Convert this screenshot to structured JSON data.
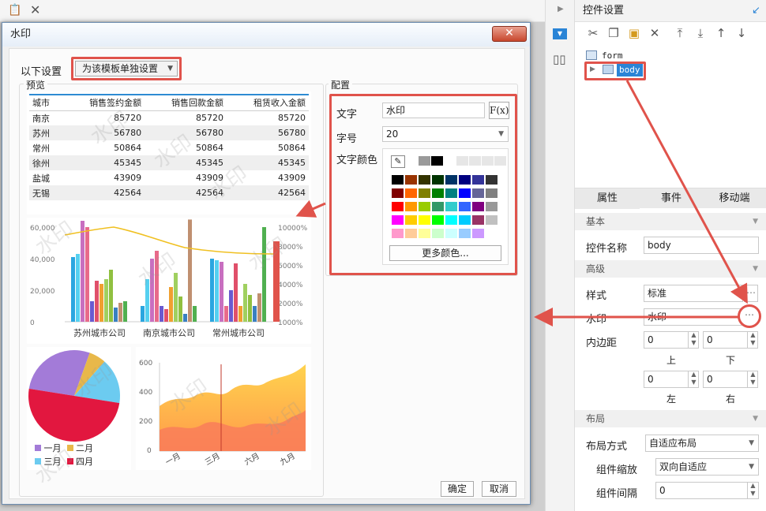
{
  "right_panel": {
    "title": "控件设置",
    "tree": {
      "form": "form",
      "body": "body"
    },
    "tabs": [
      "属性",
      "事件",
      "移动端"
    ],
    "basic": {
      "section": "基本",
      "name_label": "控件名称",
      "name_value": "body"
    },
    "advanced": {
      "section": "高级",
      "style_label": "样式",
      "style_value": "标准",
      "watermark_label": "水印",
      "watermark_value": "水印",
      "padding_label": "内边距",
      "pad_top": "0",
      "pad_bottom": "0",
      "pad_left": "0",
      "pad_right": "0",
      "top": "上",
      "bottom": "下",
      "left": "左",
      "right": "右"
    },
    "layout": {
      "section": "布局",
      "mode_label": "布局方式",
      "mode_value": "自适应布局",
      "scale_label": "组件缩放",
      "scale_value": "双向自适应",
      "gap_label": "组件间隔",
      "gap_value": "0"
    }
  },
  "dialog": {
    "title": "水印",
    "scope_label": "以下设置",
    "scope_value": "为该模板单独设置",
    "preview_label": "预览",
    "config_label": "配置",
    "text_label": "文字",
    "text_value": "水印",
    "fx": "F(x)",
    "size_label": "字号",
    "size_value": "20",
    "color_label": "文字颜色",
    "more_colors": "更多颜色...",
    "ok": "确定",
    "cancel": "取消",
    "watermark_text": "水印"
  },
  "preview_table": {
    "headers": [
      "城市",
      "销售签约金额",
      "销售回款金额",
      "租赁收入金额"
    ],
    "rows": [
      [
        "南京",
        "85720",
        "85720",
        "85720"
      ],
      [
        "苏州",
        "56780",
        "56780",
        "56780"
      ],
      [
        "常州",
        "50864",
        "50864",
        "50864"
      ],
      [
        "徐州",
        "45345",
        "45345",
        "45345"
      ],
      [
        "盐城",
        "43909",
        "43909",
        "43909"
      ],
      [
        "无锡",
        "42564",
        "42564",
        "42564"
      ]
    ]
  },
  "chart_data": [
    {
      "type": "bar",
      "categories": [
        "苏州城市公司",
        "南京城市公司",
        "常州城市公司"
      ],
      "yticks": [
        "60,000",
        "40,000",
        "20,000",
        "0"
      ],
      "y2ticks": [
        "10000%",
        "8000%",
        "6000%",
        "4000%",
        "2000%",
        "1000%"
      ],
      "ylim": [
        0,
        60000
      ],
      "series": [
        {
          "values": [
            41000,
            10000,
            40000
          ],
          "color": "#2aa6e0"
        },
        {
          "values": [
            43000,
            27000,
            39000
          ],
          "color": "#55d0f0"
        },
        {
          "values": [
            64000,
            40000,
            38000
          ],
          "color": "#c86fc0"
        },
        {
          "values": [
            60000,
            45000,
            10000
          ],
          "color": "#e86a8a"
        },
        {
          "values": [
            13000,
            10000,
            20000
          ],
          "color": "#6a5ad0"
        },
        {
          "values": [
            26000,
            8000,
            37000
          ],
          "color": "#e0506a"
        },
        {
          "values": [
            24000,
            22000,
            10000
          ],
          "color": "#f0a030"
        },
        {
          "values": [
            27000,
            31000,
            24000
          ],
          "color": "#a0d060"
        },
        {
          "values": [
            33000,
            16000,
            17000
          ],
          "color": "#90c040"
        },
        {
          "values": [
            9000,
            5000,
            10000
          ],
          "color": "#3a80c0"
        },
        {
          "values": [
            12000,
            70000,
            18000
          ],
          "color": "#c09070"
        },
        {
          "values": [
            13000,
            10000,
            60000
          ],
          "color": "#50b050"
        }
      ]
    },
    {
      "type": "pie",
      "legend": [
        "一月",
        "二月",
        "三月",
        "四月"
      ],
      "values": [
        28,
        6,
        16,
        50
      ],
      "colors": [
        "#a37bd8",
        "#e8b84a",
        "#6ccbf0",
        "#e2173f"
      ]
    },
    {
      "type": "area",
      "categories": [
        "一月",
        "三月",
        "六月",
        "九月"
      ],
      "yticks": [
        "600",
        "400",
        "200",
        "0"
      ],
      "ylim": [
        0,
        600
      ]
    }
  ]
}
